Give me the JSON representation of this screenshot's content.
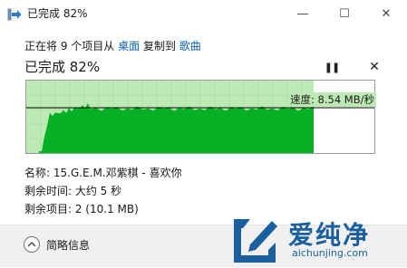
{
  "window": {
    "title": "已完成 82%",
    "icon": "copy-arrow-icon",
    "controls": {
      "minimize": "—",
      "maximize": "☐",
      "close": "✕"
    }
  },
  "copy_status": {
    "prefix": "正在将 9 个项目从",
    "source": "桌面",
    "middle": "复制到",
    "destination": "歌曲"
  },
  "headline": "已完成 82%",
  "progress": {
    "percent": 82
  },
  "controls": {
    "pause": "❚❚",
    "cancel": "✕"
  },
  "graph": {
    "speed_label": "速度: 8.54 MB/秒",
    "colors": {
      "done_bg": "#bde9b4",
      "fill": "#06b025",
      "line": "#000000",
      "grid": "#a7d89d"
    }
  },
  "details": {
    "name": "名称: 15.G.E.M.邓紫棋 - 喜欢你",
    "time_left": "剩余时间: 大约 5 秒",
    "items_left": "剩余项目: 2 (10.1 MB)"
  },
  "footer": {
    "less_details": "简略信息",
    "icon": "chevron-up-icon"
  },
  "watermark": {
    "text": "爱纯净",
    "url": "aichunjing.com"
  }
}
